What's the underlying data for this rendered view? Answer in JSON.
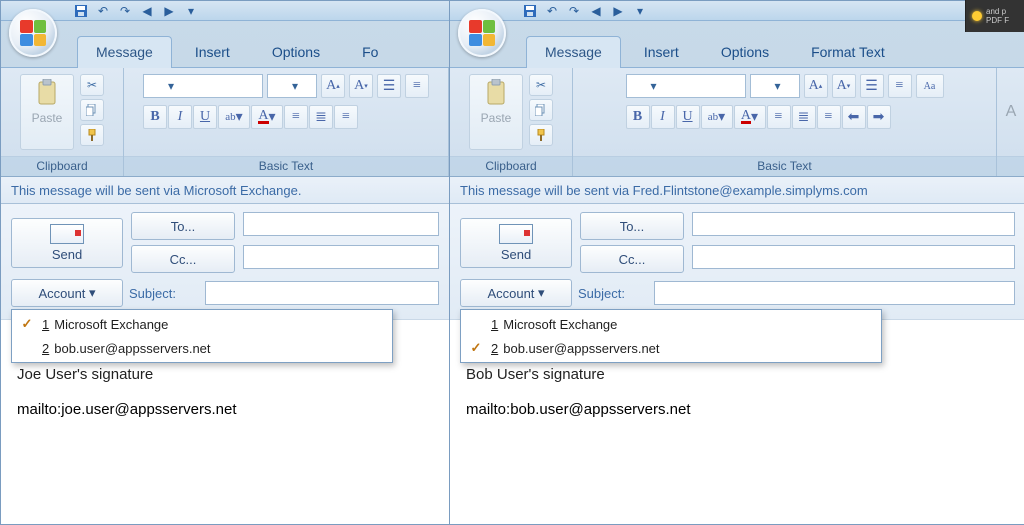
{
  "windows": [
    {
      "tabs": [
        "Message",
        "Insert",
        "Options",
        "Fo"
      ],
      "active_tab": "Message",
      "ribbon_groups": {
        "clipboard": "Clipboard",
        "basic_text": "Basic Text",
        "paste": "Paste"
      },
      "info_bar": "This message will be sent via Microsoft Exchange.",
      "header": {
        "send": "Send",
        "to": "To...",
        "cc": "Cc...",
        "account": "Account",
        "subject_label": "Subject:"
      },
      "account_menu": {
        "selected_index": 0,
        "items": [
          {
            "n": "1",
            "label": "Microsoft Exchange"
          },
          {
            "n": "2",
            "label": "bob.user@appsservers.net"
          }
        ]
      },
      "signature_line": "Joe  User's signature",
      "mailto_prefix": "mailto:",
      "mailto_address": "joe.user@appsservers.net"
    },
    {
      "tabs": [
        "Message",
        "Insert",
        "Options",
        "Format Text"
      ],
      "active_tab": "Message",
      "ribbon_groups": {
        "clipboard": "Clipboard",
        "basic_text": "Basic Text",
        "paste": "Paste"
      },
      "info_bar": "This message will be sent via Fred.Flintstone@example.simplyms.com",
      "header": {
        "send": "Send",
        "to": "To...",
        "cc": "Cc...",
        "account": "Account",
        "subject_label": "Subject:"
      },
      "account_menu": {
        "selected_index": 1,
        "items": [
          {
            "n": "1",
            "label": "Microsoft Exchange"
          },
          {
            "n": "2",
            "label": "bob.user@appsservers.net"
          }
        ]
      },
      "signature_line": "Bob User's signature",
      "mailto_prefix": "mailto:",
      "mailto_address": "bob.user@appsservers.net"
    }
  ],
  "corner_tip": {
    "line1": "and p",
    "line2": "PDF F"
  }
}
